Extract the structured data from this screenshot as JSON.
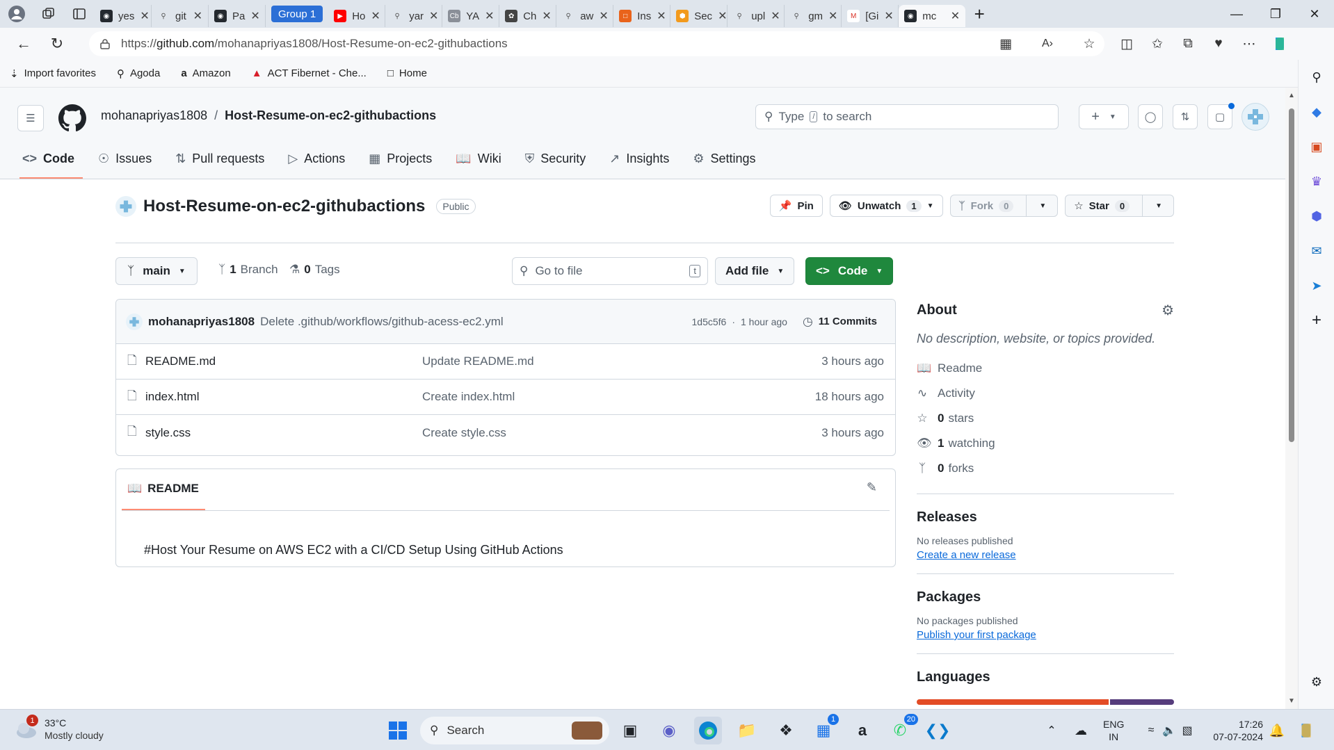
{
  "browser": {
    "tabs": [
      {
        "label": "yes",
        "icon": "github-icon"
      },
      {
        "label": "git",
        "icon": "search-icon"
      },
      {
        "label": "Pa",
        "icon": "github-icon"
      },
      {
        "label": "Ho",
        "icon": "youtube-icon"
      },
      {
        "label": "yar",
        "icon": "search-icon"
      },
      {
        "label": "YA",
        "icon": "cb-icon"
      },
      {
        "label": "Ch",
        "icon": "openai-icon"
      },
      {
        "label": "aw",
        "icon": "search-icon"
      },
      {
        "label": "Ins",
        "icon": "ins-icon"
      },
      {
        "label": "Sec",
        "icon": "aws-icon"
      },
      {
        "label": "upl",
        "icon": "search-icon"
      },
      {
        "label": "gm",
        "icon": "search-icon"
      },
      {
        "label": "[Gi",
        "icon": "gmail-icon"
      },
      {
        "label": "mc",
        "icon": "github-icon"
      }
    ],
    "tab_group_label": "Group 1",
    "url_prefix": "https://",
    "url_domain": "github.com",
    "url_path": "/mohanapriyas1808/Host-Resume-on-ec2-githubactions",
    "favorites": [
      "Import favorites",
      "Agoda",
      "Amazon",
      "ACT Fibernet - Che...",
      "Home"
    ]
  },
  "github": {
    "owner": "mohanapriyas1808",
    "separator": "/",
    "repo": "Host-Resume-on-ec2-githubactions",
    "search_placeholder_pre": "Type",
    "search_key": "/",
    "search_placeholder_post": "to search",
    "nav": [
      "Code",
      "Issues",
      "Pull requests",
      "Actions",
      "Projects",
      "Wiki",
      "Security",
      "Insights",
      "Settings"
    ],
    "visibility": "Public",
    "pin_label": "Pin",
    "unwatch_label": "Unwatch",
    "watch_count": "1",
    "fork_label": "Fork",
    "fork_count": "0",
    "star_label": "Star",
    "star_count": "0",
    "branch": "main",
    "branches_count": "1",
    "branches_label": "Branch",
    "tags_count": "0",
    "tags_label": "Tags",
    "goto_placeholder": "Go to file",
    "goto_key": "t",
    "add_file_label": "Add file",
    "code_label": "Code",
    "commit": {
      "author": "mohanapriyas1808",
      "message": "Delete .github/workflows/github-acess-ec2.yml",
      "hash": "1d5c5f6",
      "time": "1 hour ago",
      "dot": "·",
      "commits_label": "11 Commits"
    },
    "files": [
      {
        "name": "README.md",
        "message": "Update README.md",
        "time": "3 hours ago"
      },
      {
        "name": "index.html",
        "message": "Create index.html",
        "time": "18 hours ago"
      },
      {
        "name": "style.css",
        "message": "Create style.css",
        "time": "3 hours ago"
      }
    ],
    "readme_tab": "README",
    "readme_text": "#Host Your Resume on AWS EC2 with a CI/CD Setup Using GitHub Actions",
    "about": {
      "title": "About",
      "description": "No description, website, or topics provided.",
      "items": [
        {
          "icon": "book-icon",
          "text": "Readme",
          "bold": ""
        },
        {
          "icon": "pulse-icon",
          "text": "Activity",
          "bold": ""
        },
        {
          "icon": "star-icon",
          "text": "stars",
          "bold": "0"
        },
        {
          "icon": "eye-icon",
          "text": "watching",
          "bold": "1"
        },
        {
          "icon": "fork-icon",
          "text": "forks",
          "bold": "0"
        }
      ],
      "releases_title": "Releases",
      "releases_text": "No releases published",
      "releases_link": "Create a new release",
      "packages_title": "Packages",
      "packages_text": "No packages published",
      "packages_link": "Publish your first package",
      "languages_title": "Languages",
      "language_colors": [
        "#e34c26",
        "#563d7c"
      ],
      "language_shares": [
        0.75,
        0.25
      ]
    }
  },
  "taskbar": {
    "weather_temp": "33°C",
    "weather_desc": "Mostly cloudy",
    "weather_badge": "1",
    "search_label": "Search",
    "store_badge": "1",
    "whatsapp_badge": "20",
    "lang_top": "ENG",
    "lang_bottom": "IN",
    "time": "17:26",
    "date": "07-07-2024"
  }
}
